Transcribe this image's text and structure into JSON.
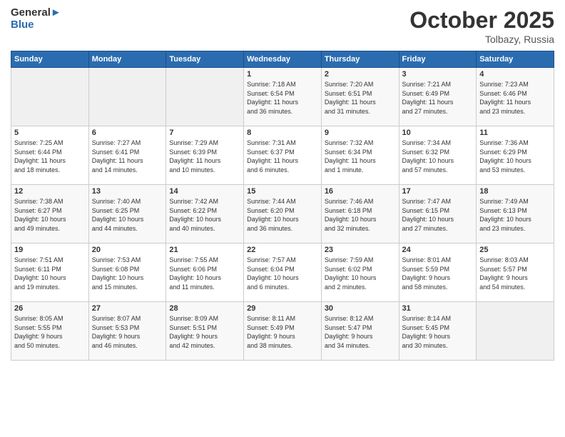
{
  "header": {
    "logo_line1": "General",
    "logo_line2": "Blue",
    "month": "October 2025",
    "location": "Tolbazy, Russia"
  },
  "days_of_week": [
    "Sunday",
    "Monday",
    "Tuesday",
    "Wednesday",
    "Thursday",
    "Friday",
    "Saturday"
  ],
  "weeks": [
    [
      {
        "day": "",
        "info": ""
      },
      {
        "day": "",
        "info": ""
      },
      {
        "day": "",
        "info": ""
      },
      {
        "day": "1",
        "info": "Sunrise: 7:18 AM\nSunset: 6:54 PM\nDaylight: 11 hours\nand 36 minutes."
      },
      {
        "day": "2",
        "info": "Sunrise: 7:20 AM\nSunset: 6:51 PM\nDaylight: 11 hours\nand 31 minutes."
      },
      {
        "day": "3",
        "info": "Sunrise: 7:21 AM\nSunset: 6:49 PM\nDaylight: 11 hours\nand 27 minutes."
      },
      {
        "day": "4",
        "info": "Sunrise: 7:23 AM\nSunset: 6:46 PM\nDaylight: 11 hours\nand 23 minutes."
      }
    ],
    [
      {
        "day": "5",
        "info": "Sunrise: 7:25 AM\nSunset: 6:44 PM\nDaylight: 11 hours\nand 18 minutes."
      },
      {
        "day": "6",
        "info": "Sunrise: 7:27 AM\nSunset: 6:41 PM\nDaylight: 11 hours\nand 14 minutes."
      },
      {
        "day": "7",
        "info": "Sunrise: 7:29 AM\nSunset: 6:39 PM\nDaylight: 11 hours\nand 10 minutes."
      },
      {
        "day": "8",
        "info": "Sunrise: 7:31 AM\nSunset: 6:37 PM\nDaylight: 11 hours\nand 6 minutes."
      },
      {
        "day": "9",
        "info": "Sunrise: 7:32 AM\nSunset: 6:34 PM\nDaylight: 11 hours\nand 1 minute."
      },
      {
        "day": "10",
        "info": "Sunrise: 7:34 AM\nSunset: 6:32 PM\nDaylight: 10 hours\nand 57 minutes."
      },
      {
        "day": "11",
        "info": "Sunrise: 7:36 AM\nSunset: 6:29 PM\nDaylight: 10 hours\nand 53 minutes."
      }
    ],
    [
      {
        "day": "12",
        "info": "Sunrise: 7:38 AM\nSunset: 6:27 PM\nDaylight: 10 hours\nand 49 minutes."
      },
      {
        "day": "13",
        "info": "Sunrise: 7:40 AM\nSunset: 6:25 PM\nDaylight: 10 hours\nand 44 minutes."
      },
      {
        "day": "14",
        "info": "Sunrise: 7:42 AM\nSunset: 6:22 PM\nDaylight: 10 hours\nand 40 minutes."
      },
      {
        "day": "15",
        "info": "Sunrise: 7:44 AM\nSunset: 6:20 PM\nDaylight: 10 hours\nand 36 minutes."
      },
      {
        "day": "16",
        "info": "Sunrise: 7:46 AM\nSunset: 6:18 PM\nDaylight: 10 hours\nand 32 minutes."
      },
      {
        "day": "17",
        "info": "Sunrise: 7:47 AM\nSunset: 6:15 PM\nDaylight: 10 hours\nand 27 minutes."
      },
      {
        "day": "18",
        "info": "Sunrise: 7:49 AM\nSunset: 6:13 PM\nDaylight: 10 hours\nand 23 minutes."
      }
    ],
    [
      {
        "day": "19",
        "info": "Sunrise: 7:51 AM\nSunset: 6:11 PM\nDaylight: 10 hours\nand 19 minutes."
      },
      {
        "day": "20",
        "info": "Sunrise: 7:53 AM\nSunset: 6:08 PM\nDaylight: 10 hours\nand 15 minutes."
      },
      {
        "day": "21",
        "info": "Sunrise: 7:55 AM\nSunset: 6:06 PM\nDaylight: 10 hours\nand 11 minutes."
      },
      {
        "day": "22",
        "info": "Sunrise: 7:57 AM\nSunset: 6:04 PM\nDaylight: 10 hours\nand 6 minutes."
      },
      {
        "day": "23",
        "info": "Sunrise: 7:59 AM\nSunset: 6:02 PM\nDaylight: 10 hours\nand 2 minutes."
      },
      {
        "day": "24",
        "info": "Sunrise: 8:01 AM\nSunset: 5:59 PM\nDaylight: 9 hours\nand 58 minutes."
      },
      {
        "day": "25",
        "info": "Sunrise: 8:03 AM\nSunset: 5:57 PM\nDaylight: 9 hours\nand 54 minutes."
      }
    ],
    [
      {
        "day": "26",
        "info": "Sunrise: 8:05 AM\nSunset: 5:55 PM\nDaylight: 9 hours\nand 50 minutes."
      },
      {
        "day": "27",
        "info": "Sunrise: 8:07 AM\nSunset: 5:53 PM\nDaylight: 9 hours\nand 46 minutes."
      },
      {
        "day": "28",
        "info": "Sunrise: 8:09 AM\nSunset: 5:51 PM\nDaylight: 9 hours\nand 42 minutes."
      },
      {
        "day": "29",
        "info": "Sunrise: 8:11 AM\nSunset: 5:49 PM\nDaylight: 9 hours\nand 38 minutes."
      },
      {
        "day": "30",
        "info": "Sunrise: 8:12 AM\nSunset: 5:47 PM\nDaylight: 9 hours\nand 34 minutes."
      },
      {
        "day": "31",
        "info": "Sunrise: 8:14 AM\nSunset: 5:45 PM\nDaylight: 9 hours\nand 30 minutes."
      },
      {
        "day": "",
        "info": ""
      }
    ]
  ]
}
